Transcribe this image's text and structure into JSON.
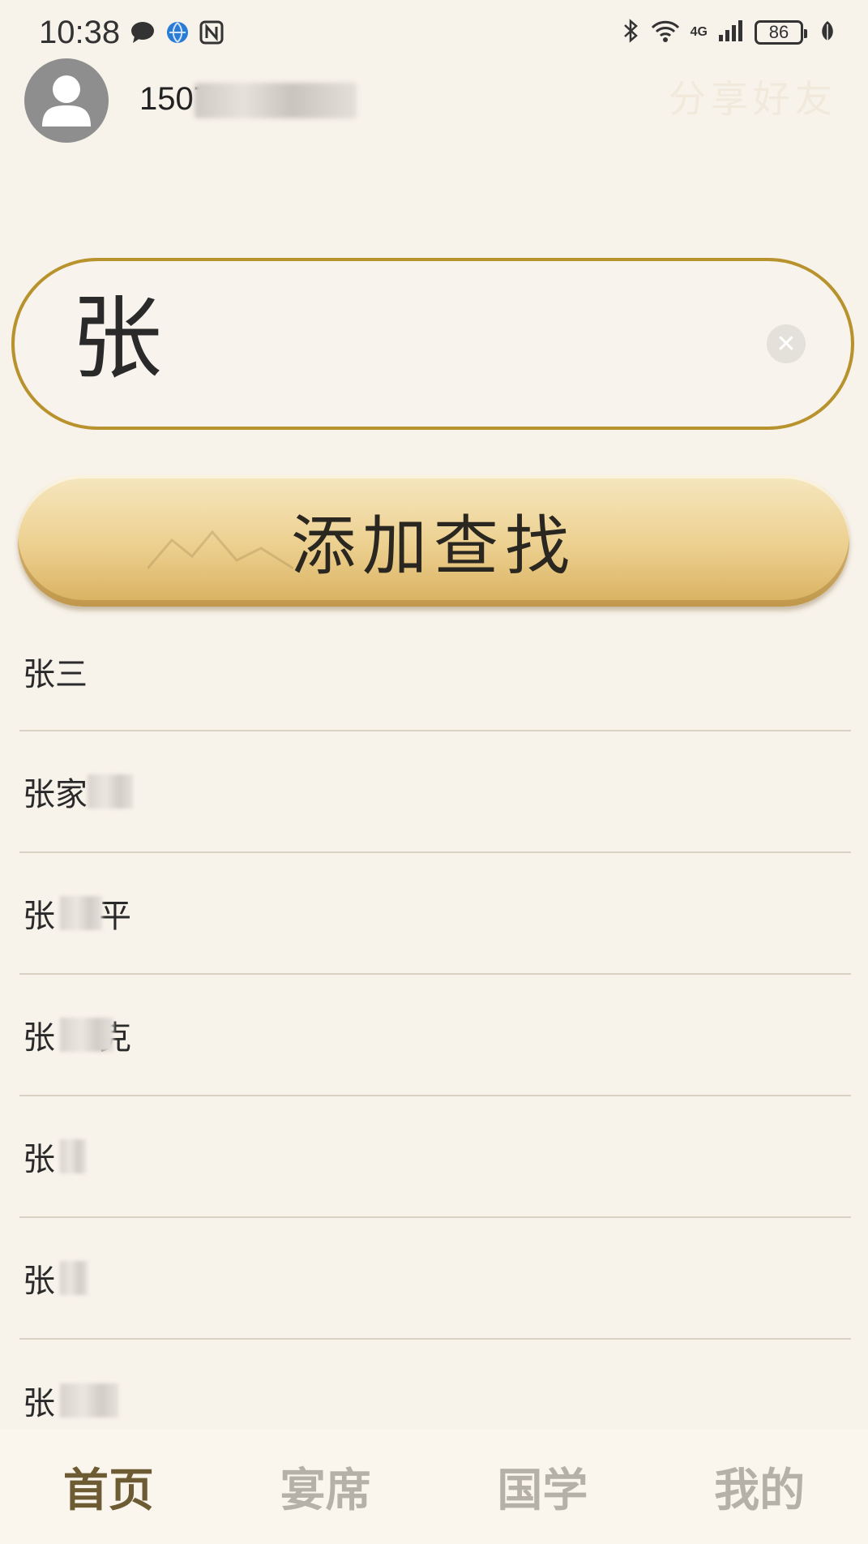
{
  "status_bar": {
    "time": "10:38",
    "network": "4G",
    "battery": "86"
  },
  "header": {
    "phone": "15071",
    "share_label": "分享好友"
  },
  "search": {
    "value": "张",
    "clear_icon": "close-icon"
  },
  "add_search_button": {
    "label": "添加查找"
  },
  "results": [
    {
      "name": "张三"
    },
    {
      "name": "张家"
    },
    {
      "name": "张",
      "suffix": "平"
    },
    {
      "name": "张",
      "suffix": "克"
    },
    {
      "name": "张"
    },
    {
      "name": "张"
    },
    {
      "name": "张"
    }
  ],
  "bottom_nav": {
    "items": [
      {
        "label": "首页",
        "active": true
      },
      {
        "label": "宴席",
        "active": false
      },
      {
        "label": "国学",
        "active": false
      },
      {
        "label": "我的",
        "active": false
      }
    ]
  },
  "colors": {
    "background": "#f7f2ea",
    "accent_gold": "#b8922c",
    "button_gold": "#eccf8e",
    "nav_active": "#6d5b33",
    "nav_inactive": "#b5b0a8"
  }
}
